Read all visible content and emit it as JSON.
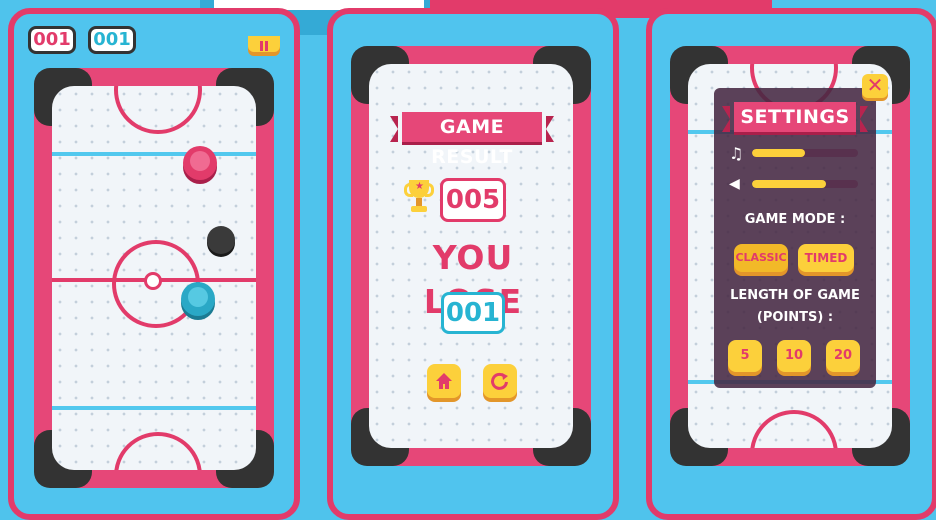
{
  "left_panel": {
    "score_red": "001",
    "score_blue": "001",
    "pause_icon": "pause-icon"
  },
  "result_panel": {
    "title": "GAME RESULT",
    "best_score": "005",
    "message": "YOU LOSE",
    "player_score": "001",
    "home_icon": "home-icon",
    "restart_icon": "restart-icon"
  },
  "settings_panel": {
    "title": "SETTINGS",
    "music_level": 0.5,
    "sound_level": 0.7,
    "mode_label": "GAME MODE :",
    "mode_classic": "CLASSIC",
    "mode_timed": "TIMED",
    "length_label_1": "LENGTH OF GAME",
    "length_label_2": "(POINTS) :",
    "length_options": [
      "5",
      "10",
      "20"
    ]
  },
  "colors": {
    "pink": "#e23b6a",
    "blue": "#52c8ee",
    "yellow": "#fcd03b",
    "dark": "#333333"
  }
}
